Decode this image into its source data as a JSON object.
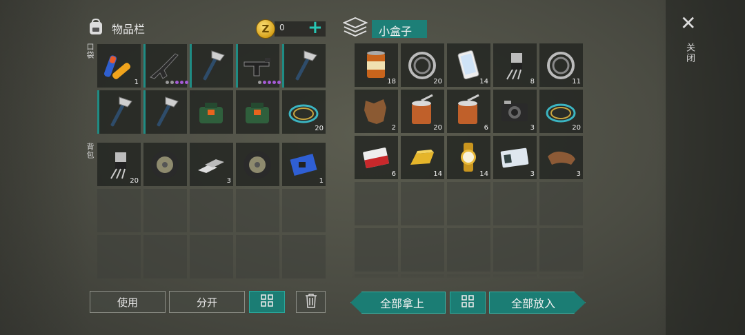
{
  "inventory": {
    "title": "物品栏",
    "coins": "0",
    "pocket_label": "口袋",
    "backpack_label": "背包",
    "pocket_slots": [
      {
        "item": "batteries",
        "qty": "1",
        "dots": 0
      },
      {
        "item": "assault-rifle",
        "qty": "",
        "dots": 5
      },
      {
        "item": "hatchet",
        "qty": "",
        "dots": 0
      },
      {
        "item": "smg",
        "qty": "",
        "dots": 6
      },
      {
        "item": "hatchet",
        "qty": "",
        "dots": 0
      },
      {
        "item": "hatchet",
        "qty": "",
        "dots": 0
      },
      {
        "item": "hatchet",
        "qty": "",
        "dots": 0
      },
      {
        "item": "medkit-bag",
        "qty": "",
        "dots": 0
      },
      {
        "item": "medkit-bag",
        "qty": "",
        "dots": 0
      },
      {
        "item": "wire-coil",
        "qty": "20",
        "dots": 0
      }
    ],
    "backpack_slots": [
      {
        "item": "transistor",
        "qty": "20"
      },
      {
        "item": "wheel",
        "qty": ""
      },
      {
        "item": "metal-bars",
        "qty": "3"
      },
      {
        "item": "wheel",
        "qty": ""
      },
      {
        "item": "circuit-board",
        "qty": "1"
      },
      {
        "item": "",
        "qty": ""
      },
      {
        "item": "",
        "qty": ""
      },
      {
        "item": "",
        "qty": ""
      },
      {
        "item": "",
        "qty": ""
      },
      {
        "item": "",
        "qty": ""
      },
      {
        "item": "",
        "qty": ""
      },
      {
        "item": "",
        "qty": ""
      },
      {
        "item": "",
        "qty": ""
      },
      {
        "item": "",
        "qty": ""
      },
      {
        "item": "",
        "qty": ""
      }
    ]
  },
  "box": {
    "title": "小盒子",
    "slots": [
      {
        "item": "food-can",
        "qty": "18"
      },
      {
        "item": "bearing",
        "qty": "20"
      },
      {
        "item": "smartphone",
        "qty": "14"
      },
      {
        "item": "transistor",
        "qty": "8"
      },
      {
        "item": "bearing",
        "qty": "11"
      },
      {
        "item": "animal-hide",
        "qty": "2"
      },
      {
        "item": "open-can",
        "qty": "20"
      },
      {
        "item": "open-can",
        "qty": "6"
      },
      {
        "item": "camera",
        "qty": "3"
      },
      {
        "item": "wire-coil",
        "qty": "20"
      },
      {
        "item": "cigarettes",
        "qty": "6"
      },
      {
        "item": "gold-bar",
        "qty": "14"
      },
      {
        "item": "gold-watch",
        "qty": "14"
      },
      {
        "item": "id-card",
        "qty": "3"
      },
      {
        "item": "leather",
        "qty": "3"
      },
      {
        "item": "",
        "qty": ""
      },
      {
        "item": "",
        "qty": ""
      },
      {
        "item": "",
        "qty": ""
      },
      {
        "item": "",
        "qty": ""
      },
      {
        "item": "",
        "qty": ""
      },
      {
        "item": "",
        "qty": ""
      },
      {
        "item": "",
        "qty": ""
      },
      {
        "item": "",
        "qty": ""
      },
      {
        "item": "",
        "qty": ""
      },
      {
        "item": "",
        "qty": ""
      },
      {
        "item": "",
        "qty": ""
      },
      {
        "item": "",
        "qty": ""
      },
      {
        "item": "",
        "qty": ""
      },
      {
        "item": "",
        "qty": ""
      },
      {
        "item": "",
        "qty": ""
      }
    ]
  },
  "buttons": {
    "use": "使用",
    "split": "分开",
    "take_all": "全部拿上",
    "put_all": "全部放入"
  },
  "close_label": "关闭",
  "colors": {
    "accent": "#1b7d74",
    "plus": "#27c6b4",
    "rarity": "#a55bd6"
  }
}
